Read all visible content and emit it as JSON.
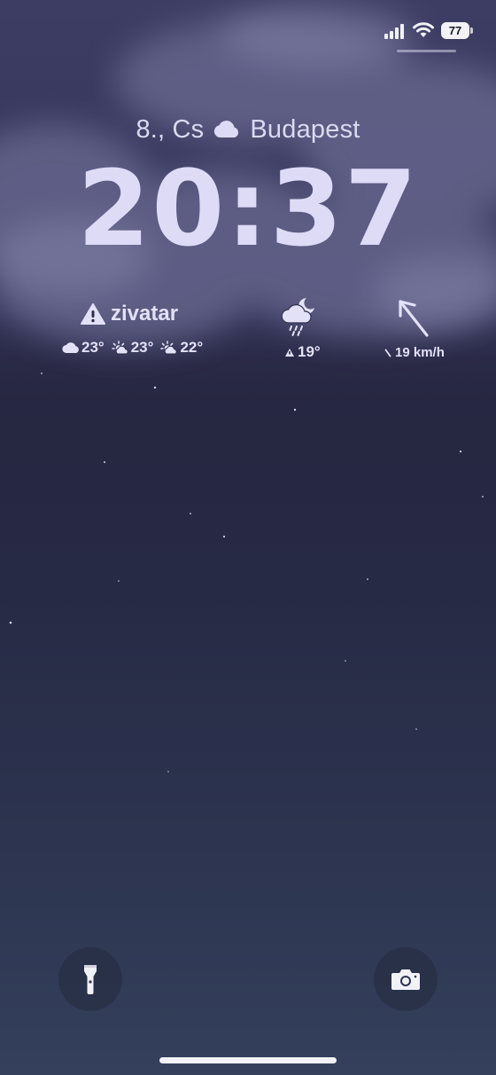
{
  "status_bar": {
    "battery_level": "77",
    "icons": [
      "cellular-signal-icon",
      "wifi-icon",
      "battery-icon"
    ]
  },
  "lock_screen": {
    "date_text": "8., Cs",
    "location_icon": "cloud-icon",
    "location": "Budapest",
    "time": "20:37"
  },
  "widgets": {
    "forecast": {
      "alert_icon": "warning-triangle-icon",
      "alert_label": "zivatar",
      "items": [
        {
          "icon": "cloud-icon",
          "temp": "23°"
        },
        {
          "icon": "partly-sunny-icon",
          "temp": "23°"
        },
        {
          "icon": "partly-sunny-icon",
          "temp": "22°"
        }
      ]
    },
    "current": {
      "icon": "night-rain-cloud-icon",
      "temp": "19°",
      "temp_icon": "low-temp-triangle-icon"
    },
    "wind": {
      "icon": "wind-direction-arrow-icon",
      "speed_text": "19 km/h"
    }
  },
  "quick_actions": {
    "flashlight_icon": "flashlight-icon",
    "camera_icon": "camera-icon"
  },
  "colors": {
    "text": "#dedbf7",
    "sky_top": "#2a2a48",
    "sky_bottom": "#34405c"
  }
}
